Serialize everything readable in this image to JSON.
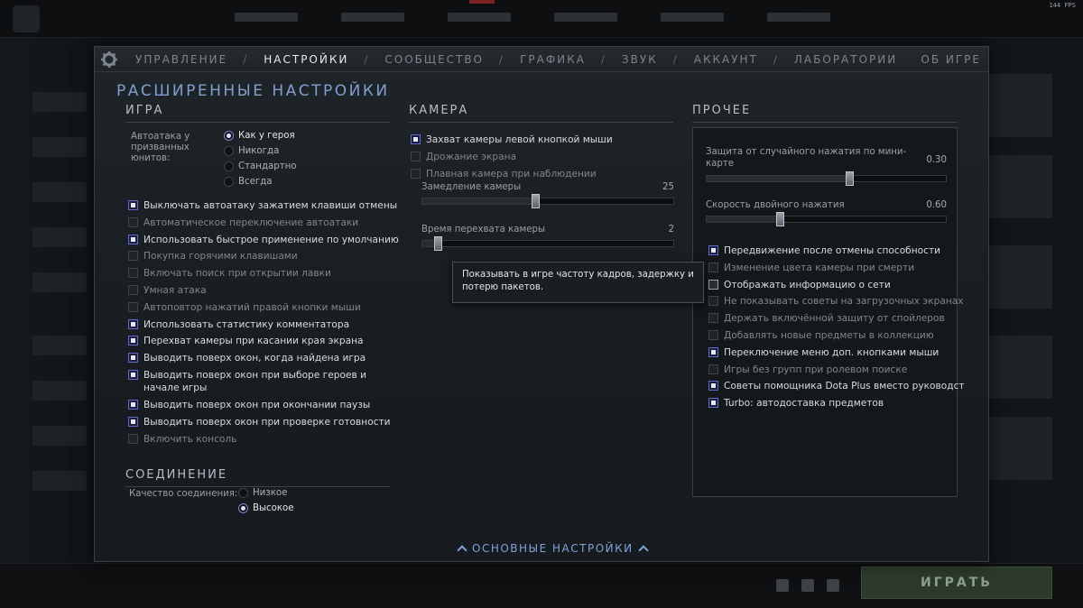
{
  "fps": "144 FPS",
  "bg": {
    "play_label": "ИГРАТЬ"
  },
  "tabs": {
    "items": [
      "УПРАВЛЕНИЕ",
      "НАСТРОЙКИ",
      "СООБЩЕСТВО",
      "ГРАФИКА",
      "ЗВУК",
      "АККАУНТ",
      "ЛАБОРАТОРИИ"
    ],
    "active": "НАСТРОЙКИ",
    "separator": "/",
    "about": "ОБ ИГРЕ"
  },
  "title": "РАСШИРЕННЫЕ НАСТРОЙКИ",
  "game": {
    "heading": "ИГРА",
    "autoattack_label": "Автоатака у призванных юнитов:",
    "autoattack_options": [
      "Как у героя",
      "Никогда",
      "Стандартно",
      "Всегда"
    ],
    "autoattack_selected": 0,
    "options": [
      {
        "label": "Выключать автоатаку зажатием клавиши отмены",
        "checked": true
      },
      {
        "label": "Автоматическое переключение автоатаки",
        "checked": false
      },
      {
        "label": "Использовать быстрое применение по умолчанию",
        "checked": true
      },
      {
        "label": "Покупка горячими клавишами",
        "checked": false
      },
      {
        "label": "Включать поиск при открытии лавки",
        "checked": false
      },
      {
        "label": "Умная атака",
        "checked": false
      },
      {
        "label": "Автоповтор нажатий правой кнопки мыши",
        "checked": false
      },
      {
        "label": "Использовать статистику комментатора",
        "checked": true
      },
      {
        "label": "Перехват камеры при касании края экрана",
        "checked": true
      },
      {
        "label": "Выводить поверх окон, когда найдена игра",
        "checked": true
      },
      {
        "label": "Выводить поверх окон при выборе героев и начале игры",
        "checked": true
      },
      {
        "label": "Выводить поверх окон при окончании паузы",
        "checked": true
      },
      {
        "label": "Выводить поверх окон при проверке готовности",
        "checked": true
      },
      {
        "label": "Включить консоль",
        "checked": false
      }
    ]
  },
  "connection": {
    "heading": "СОЕДИНЕНИЕ",
    "label": "Качество соединения:",
    "options": [
      "Низкое",
      "Высокое"
    ],
    "selected": 1
  },
  "camera": {
    "heading": "КАМЕРА",
    "options": [
      {
        "label": "Захват камеры левой кнопкой мыши",
        "checked": true
      },
      {
        "label": "Дрожание экрана",
        "checked": false
      },
      {
        "label": "Плавная камера при наблюдении",
        "checked": false
      }
    ],
    "sliders": [
      {
        "label": "Замедление камеры",
        "value": "25",
        "fraction": 0.45
      },
      {
        "label": "Время перехвата камеры",
        "value": "2",
        "fraction": 0.05
      }
    ]
  },
  "tooltip": "Показывать в игре частоту кадров, задержку и потерю пакетов.",
  "other": {
    "heading": "ПРОЧЕЕ",
    "sliders": [
      {
        "label": "Защита от случайного нажатия по мини-карте",
        "value": "0.30",
        "fraction": 0.6
      },
      {
        "label": "Скорость двойного нажатия",
        "value": "0.60",
        "fraction": 0.3
      }
    ],
    "options": [
      {
        "label": "Передвижение после отмены способности",
        "state": "on"
      },
      {
        "label": "Изменение цвета камеры при смерти",
        "state": "off"
      },
      {
        "label": "Отображать информацию о сети",
        "state": "hover"
      },
      {
        "label": "Не показывать советы на загрузочных экранах",
        "state": "off"
      },
      {
        "label": "Держать включённой защиту от спойлеров",
        "state": "off"
      },
      {
        "label": "Добавлять новые предметы в коллекцию",
        "state": "off"
      },
      {
        "label": "Переключение меню доп. кнопками мыши",
        "state": "on"
      },
      {
        "label": "Игры без групп при ролевом поиске",
        "state": "off"
      },
      {
        "label": "Советы помощника Dota Plus вместо руководст",
        "state": "on"
      },
      {
        "label": "Turbo: автодоставка предметов",
        "state": "on"
      }
    ]
  },
  "bottom_link": "ОСНОВНЫЕ НАСТРОЙКИ"
}
